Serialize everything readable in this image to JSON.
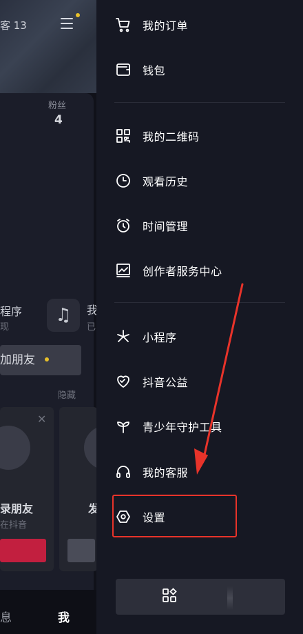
{
  "background": {
    "visitors_text": "客 13",
    "fans_label": "粉丝",
    "fans_count": "4",
    "mini_program_label": "程序",
    "mini_program_sub": "现",
    "music_label": "我",
    "music_sub": "已",
    "add_friends_label": "加朋友",
    "hide_label": "隐藏",
    "card1_title": "录朋友",
    "card1_sub": "在抖音",
    "card2_title": "发",
    "tab_messages": "息",
    "tab_me": "我"
  },
  "drawer": {
    "items": [
      {
        "label": "我的订单",
        "icon": "cart-icon"
      },
      {
        "label": "钱包",
        "icon": "wallet-icon"
      },
      {
        "label": "我的二维码",
        "icon": "qrcode-icon"
      },
      {
        "label": "观看历史",
        "icon": "clock-icon"
      },
      {
        "label": "时间管理",
        "icon": "alarm-icon"
      },
      {
        "label": "创作者服务中心",
        "icon": "chart-icon"
      },
      {
        "label": "小程序",
        "icon": "asterisk-icon"
      },
      {
        "label": "抖音公益",
        "icon": "heart-icon"
      },
      {
        "label": "青少年守护工具",
        "icon": "sprout-icon"
      },
      {
        "label": "我的客服",
        "icon": "headset-icon"
      },
      {
        "label": "设置",
        "icon": "hexagon-icon"
      }
    ],
    "bottom_button_icon": "more-apps-icon"
  },
  "annotation": {
    "highlight_color": "#e8332a",
    "arrow_color": "#e8332a"
  }
}
